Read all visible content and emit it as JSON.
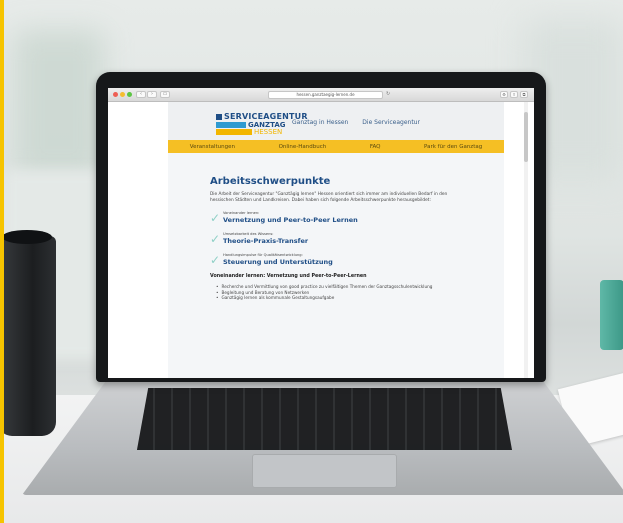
{
  "browser": {
    "address": "hessen.ganztaegig-lernen.de",
    "back_icon": "chevron-left-icon",
    "forward_icon": "chevron-right-icon",
    "view_icon": "sidebar-icon",
    "reload_icon": "reload-icon"
  },
  "site": {
    "logo_line1": "SERVICEAGENTUR",
    "logo_line2": "GANZTAG",
    "logo_line3": "HESSEN",
    "top_nav": [
      "Ganztag in Hessen",
      "Die Serviceagentur"
    ],
    "menu": [
      "Veranstaltungen",
      "Online-Handbuch",
      "FAQ",
      "Park für den Ganztag"
    ]
  },
  "main": {
    "title": "Arbeitsschwerpunkte",
    "intro": "Die Arbeit der Serviceagentur \"Ganztägig lernen\" Hessen orientiert sich immer am individuellen Bedarf in den hessischen Städten und Landkreisen. Dabei haben sich folgende Arbeitsschwerpunkte herausgebildet:",
    "points": [
      {
        "small": "Voneinander lernen:",
        "big": "Vernetzung und Peer-to-Peer Lernen"
      },
      {
        "small": "Umsetzbarkeit des Wissens:",
        "big": "Theorie-Praxis-Transfer"
      },
      {
        "small": "Handlungsimpulse für Qualitätsentwicklung:",
        "big": "Steuerung und Unterstützung"
      }
    ],
    "subhead": "Voneinander lernen: Vernetzung und Peer-to-Peer-Lernen",
    "bullets": [
      "Recherche und Vermittlung von good practice zu vielfältigen Themen der Ganztagsschulentwicklung",
      "Begleitung und Beratung von Netzwerken",
      "Ganztägig lernen als kommunale Gestaltungsaufgabe"
    ]
  },
  "colors": {
    "frame": "#f6c400",
    "brand_blue": "#1f4e86",
    "menu_yellow": "#f5bf24",
    "check_teal": "#8fd0c6"
  }
}
